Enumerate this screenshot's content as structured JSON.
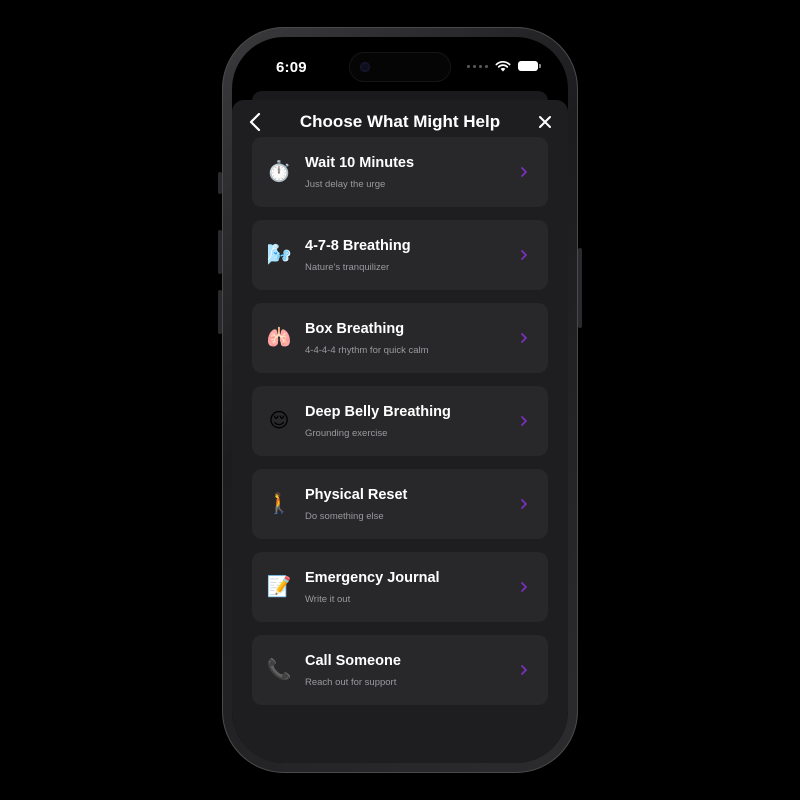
{
  "status_bar": {
    "time": "6:09"
  },
  "header": {
    "title": "Choose What Might Help",
    "back_icon": "chevron-left-icon",
    "close_icon": "close-icon"
  },
  "colors": {
    "background": "#000000",
    "sheet": "#1e1e20",
    "card": "#28282a",
    "accent_chevron": "#7b2fbe",
    "subtitle": "#9a9a9e"
  },
  "options": [
    {
      "emoji": "⏱️",
      "icon": "stopwatch-icon",
      "title": "Wait 10 Minutes",
      "subtitle": "Just delay the urge"
    },
    {
      "emoji": "🌬️",
      "icon": "wind-face-icon",
      "title": "4-7-8 Breathing",
      "subtitle": "Nature's tranquilizer"
    },
    {
      "emoji": "🫁",
      "icon": "lungs-icon",
      "title": "Box Breathing",
      "subtitle": "4-4-4-4 rhythm for quick calm"
    },
    {
      "emoji": "😌",
      "icon": "relieved-face-icon",
      "title": "Deep Belly Breathing",
      "subtitle": "Grounding exercise"
    },
    {
      "emoji": "🚶",
      "icon": "walking-person-icon",
      "title": "Physical Reset",
      "subtitle": "Do something else"
    },
    {
      "emoji": "📝",
      "icon": "memo-icon",
      "title": "Emergency Journal",
      "subtitle": "Write it out"
    },
    {
      "emoji": "📞",
      "icon": "telephone-icon",
      "title": "Call Someone",
      "subtitle": "Reach out for support"
    }
  ]
}
